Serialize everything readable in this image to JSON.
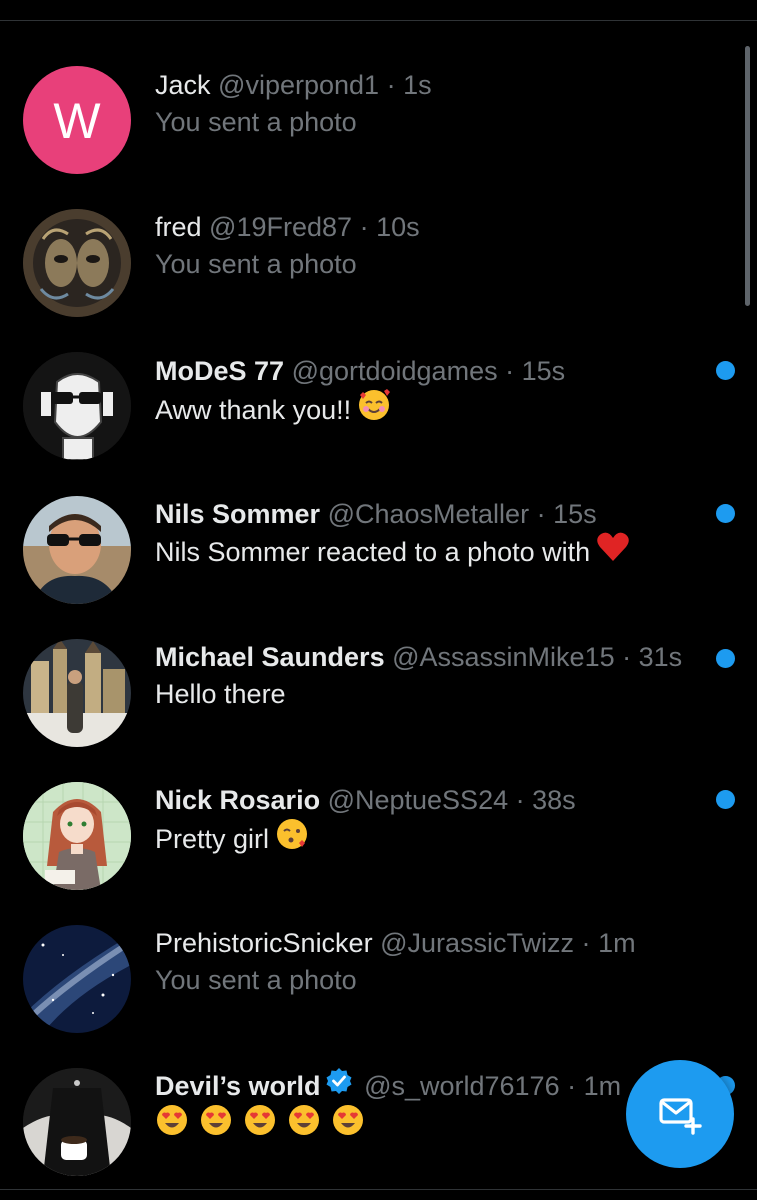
{
  "conversations": [
    {
      "name": "Jack",
      "handle": "@viperpond1",
      "sep": "·",
      "time": "1s",
      "preview": "You sent a photo",
      "avatar_letter": "W",
      "avatar_color": "#e8407a"
    },
    {
      "name": "fred",
      "handle": "@19Fred87",
      "sep": "·",
      "time": "10s",
      "preview": "You sent a photo"
    },
    {
      "name": "MoDeS 77",
      "handle": "@gortdoidgames",
      "sep": "·",
      "time": "15s",
      "preview": "Aww thank you!!",
      "emoji": "smiling-face-with-hearts"
    },
    {
      "name": "Nils Sommer",
      "handle": "@ChaosMetaller",
      "sep": "·",
      "time": "15s",
      "preview": "Nils Sommer reacted to a photo with",
      "emoji": "red-heart"
    },
    {
      "name": "Michael Saunders",
      "handle": "@AssassinMike15",
      "sep": "·",
      "time": "31s",
      "preview": "Hello there"
    },
    {
      "name": "Nick Rosario",
      "handle": "@NeptueSS24",
      "sep": "·",
      "time": "38s",
      "preview": "Pretty girl",
      "emoji": "face-blowing-a-kiss"
    },
    {
      "name": "PrehistoricSnicker",
      "handle": "@JurassicTwizz",
      "sep": "·",
      "time": "1m",
      "preview": "You sent a photo"
    },
    {
      "name": "Devil’s world",
      "handle": "@s_world76176",
      "sep": "·",
      "time": "1m",
      "preview": "",
      "verified": true,
      "emoji": "heart-eyes x5"
    }
  ],
  "colors": {
    "accent": "#1d9bf0",
    "background": "#000000",
    "text": "#e7e9ea",
    "muted": "#71767b"
  },
  "fab": {
    "icon": "new-message-icon"
  }
}
